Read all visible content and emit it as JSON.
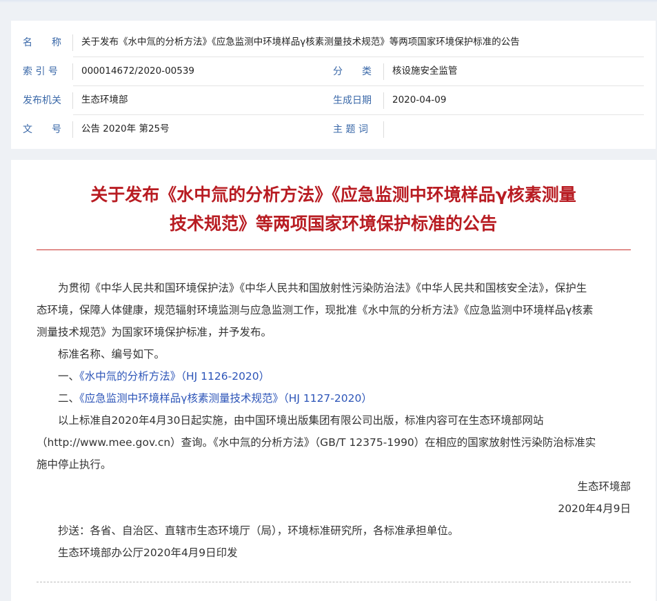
{
  "meta": {
    "name_label": "名　　称",
    "name_value": "关于发布《水中氚的分析方法》《应急监测中环境样品γ核素测量技术规范》等两项国家环境保护标准的公告",
    "index_label": "索 引 号",
    "index_value": "000014672/2020-00539",
    "category_label": "分　　类",
    "category_value": "核设施安全监管",
    "issuer_label": "发布机关",
    "issuer_value": "生态环境部",
    "date_label": "生成日期",
    "date_value": "2020-04-09",
    "docno_label": "文　　号",
    "docno_value": "公告 2020年 第25号",
    "subject_label": "主 题 词",
    "subject_value": ""
  },
  "article": {
    "title_line1": "关于发布《水中氚的分析方法》《应急监测中环境样品γ核素测量",
    "title_line2": "技术规范》等两项国家环境保护标准的公告",
    "p1_line1": "　　为贯彻《中华人民共和国环境保护法》《中华人民共和国放射性污染防治法》《中华人民共和国核安全法》，保护生",
    "p1_line2": "态环境，保障人体健康，规范辐射环境监测与应急监测工作，现批准《水中氚的分析方法》《应急监测中环境样品γ核素",
    "p1_line3": "测量技术规范》为国家环境保护标准，并予发布。",
    "p2": "　　标准名称、编号如下。",
    "item1_prefix": "　　一、",
    "item1_link": "《水中氚的分析方法》（HJ 1126-2020）",
    "item2_prefix": "　　二、",
    "item2_link": "《应急监测中环境样品γ核素测量技术规范》（HJ 1127-2020）",
    "p3_line1": "　　以上标准自2020年4月30日起实施，由中国环境出版集团有限公司出版，标准内容可在生态环境部网站",
    "p3_line2": "（http://www.mee.gov.cn）查询。《水中氚的分析方法》（GB/T 12375-1990）在相应的国家放射性污染防治标准实",
    "p3_line3": "施中停止执行。",
    "signature": "生态环境部",
    "sign_date": "2020年4月9日",
    "cc": "　　抄送：各省、自治区、直辖市生态环境厅（局），环境标准研究所，各标准承担单位。",
    "printed": "　　生态环境部办公厅2020年4月9日印发"
  }
}
